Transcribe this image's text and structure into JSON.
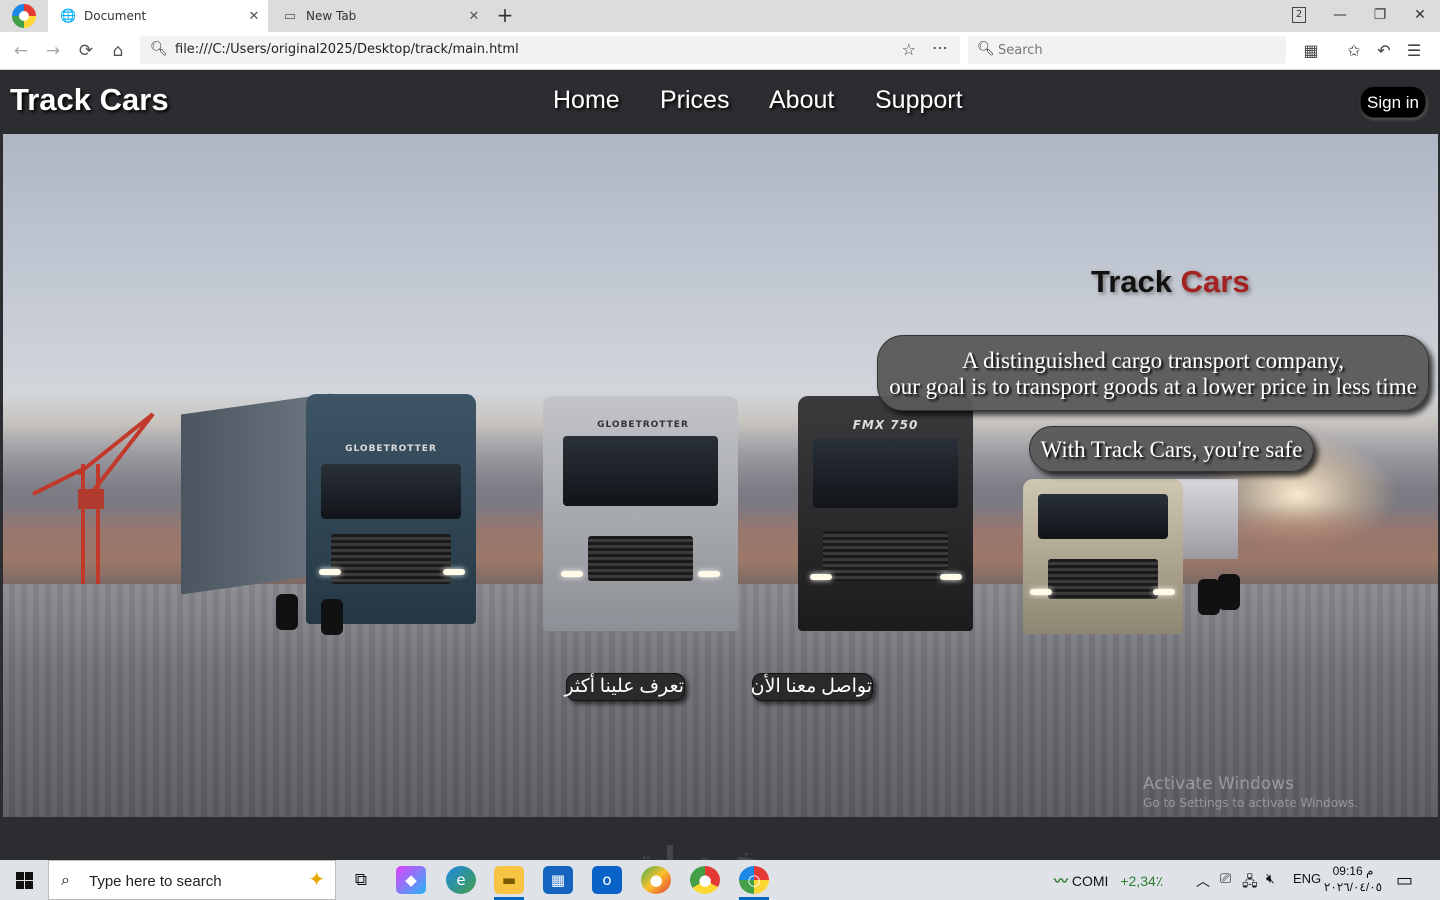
{
  "browser": {
    "tabs": [
      {
        "title": "Document",
        "icon": "globe-icon",
        "close": "✕",
        "active": true
      },
      {
        "title": "New Tab",
        "icon": "newtab-icon",
        "close": "✕",
        "active": false
      }
    ],
    "new_tab_symbol": "+",
    "tab_count": "2",
    "window_controls": {
      "minimize": "—",
      "restore": "❐",
      "close": "✕"
    },
    "nav": {
      "back": "←",
      "forward": "→",
      "reload": "⟳",
      "home": "⌂"
    },
    "url": "file:///C:/Users/original2025/Desktop/track/main.html",
    "search_placeholder": "Search"
  },
  "site": {
    "logo": "Track Cars",
    "menu": [
      "Home",
      "Prices",
      "About",
      "Support"
    ],
    "signin_label": "Sign in",
    "hero": {
      "title_part1": "Track",
      "title_part2": "Cars",
      "description_line1": "A distinguished cargo transport company,",
      "description_line2": "our goal is to transport goods at a lower price in less time",
      "tagline": "With Track Cars, you're safe",
      "cta_about": "تعرف علينا أكثر",
      "cta_contact": "تواصل معنا الأن"
    },
    "truck_badges": [
      "GLOBETROTTER",
      "GLOBETROTTER",
      "FMX 750",
      ""
    ],
    "colors": {
      "header_bg": "#2c2d30",
      "title_accent": "#a32323",
      "bubble_bg": "#5a585a"
    }
  },
  "overlay": {
    "activate_title": "Activate Windows",
    "activate_sub": "Go to Settings to activate Windows.",
    "site_watermark": "خمسات"
  },
  "taskbar": {
    "search_placeholder": "Type here to search",
    "stock_name": "COMI",
    "stock_change": "+2,34٪",
    "language": "ENG",
    "time": "09:16 م",
    "date": "٢٠٢٦/٠٤/٠٥"
  }
}
